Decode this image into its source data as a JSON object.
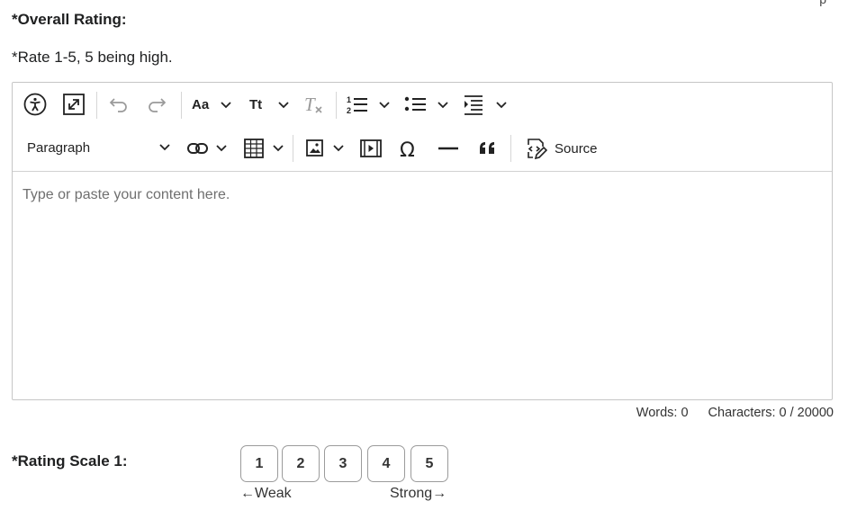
{
  "form": {
    "overall_title": "*Overall Rating:",
    "instruction": "*Rate 1-5, 5 being high.",
    "corner_mark": "p"
  },
  "editor": {
    "paragraph_label": "Paragraph",
    "source_label": "Source",
    "placeholder": "Type or paste your content here.",
    "toolbar_icons": [
      "accessibility-icon",
      "fullscreen-icon",
      "undo-icon",
      "redo-icon",
      "font-family-icon",
      "font-size-icon",
      "remove-format-icon",
      "numbered-list-icon",
      "bulleted-list-icon",
      "indent-icon",
      "link-icon",
      "table-icon",
      "image-icon",
      "media-icon",
      "special-characters-icon",
      "horizontal-line-icon",
      "blockquote-icon",
      "source-icon"
    ]
  },
  "counter": {
    "words": "Words: 0",
    "characters": "Characters: 0 / 20000"
  },
  "rating_scale": {
    "label": "*Rating Scale 1:",
    "options": [
      "1",
      "2",
      "3",
      "4",
      "5"
    ],
    "low_hint": "←Weak",
    "high_hint": "Strong→"
  }
}
